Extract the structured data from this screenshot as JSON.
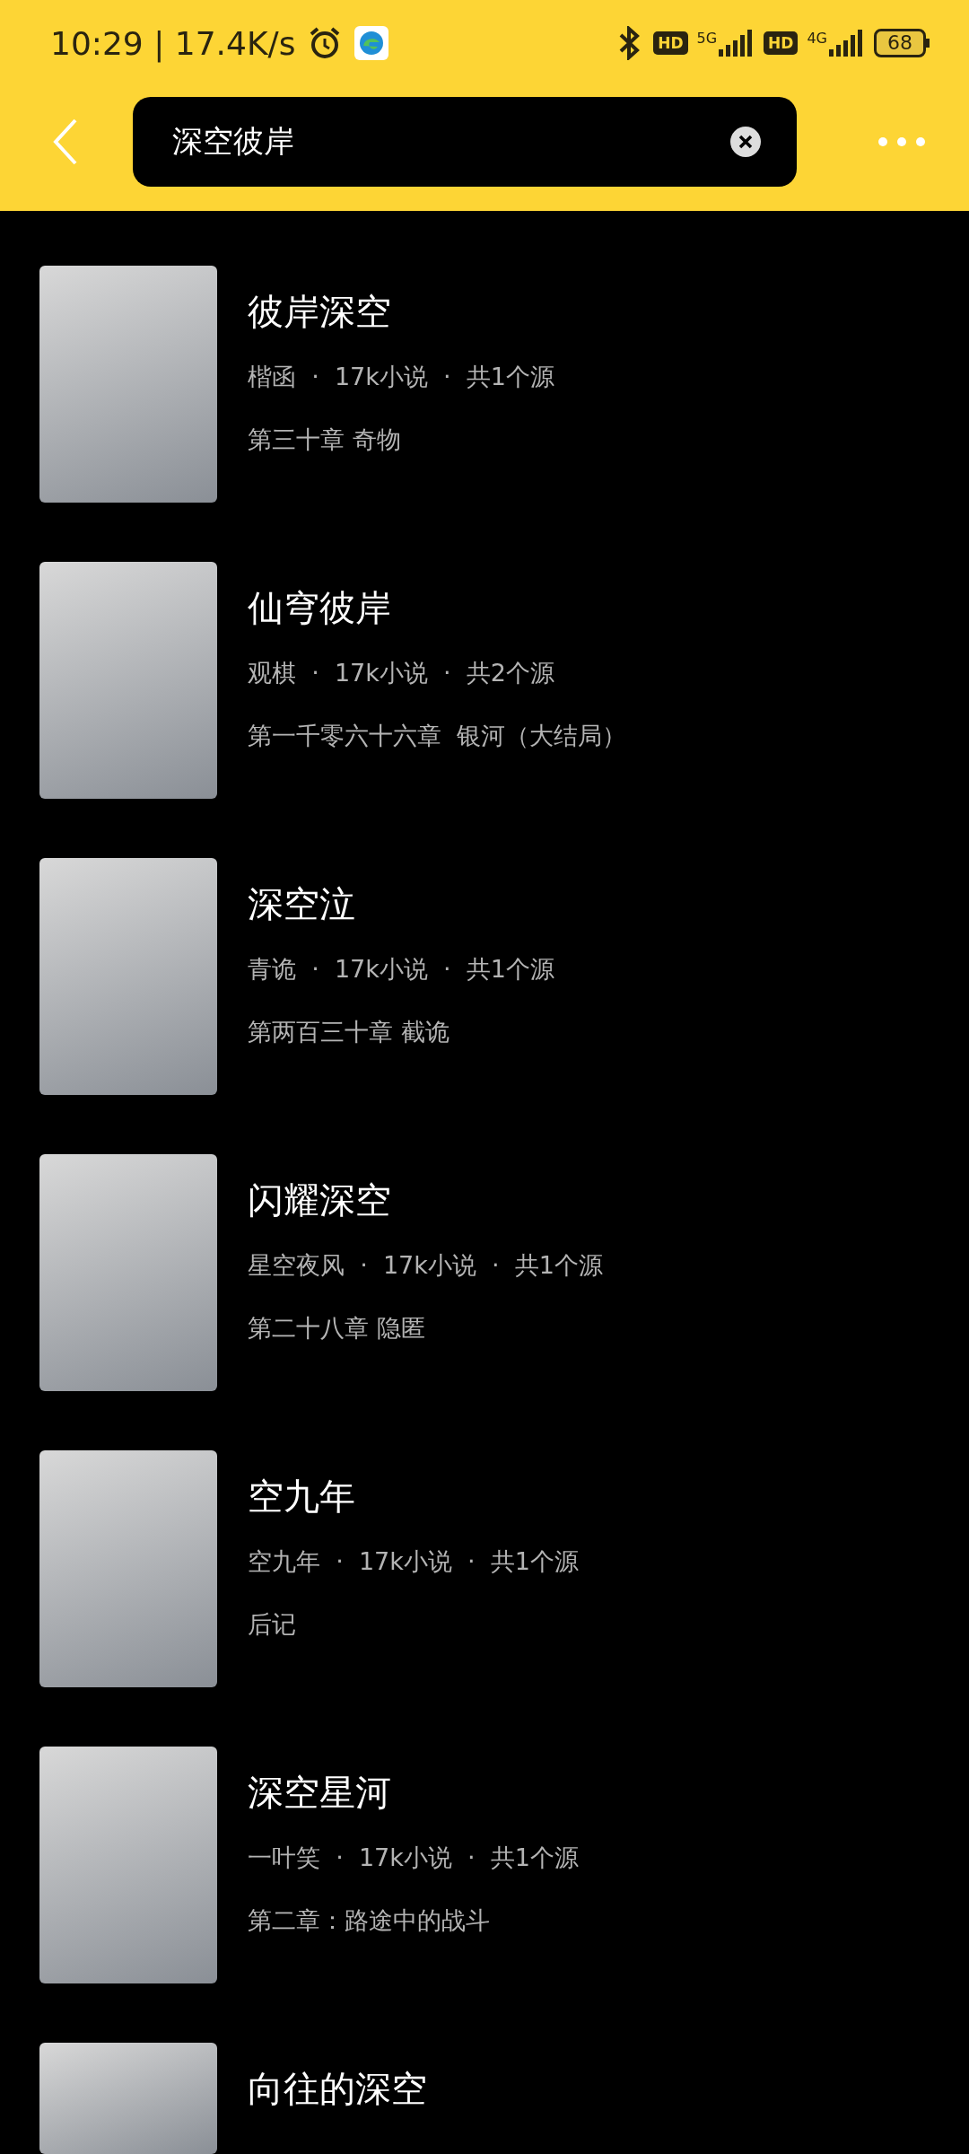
{
  "status_bar": {
    "time": "10:29 | 17.4K/s",
    "hd_1": "HD",
    "network_1": "5G",
    "hd_2": "HD",
    "network_2": "4G",
    "battery": "68"
  },
  "search": {
    "value": "深空彼岸"
  },
  "books": [
    {
      "title": "彼岸深空",
      "meta": "楷函  ·  17k小说  ·  共1个源",
      "chapter": "第三十章 奇物"
    },
    {
      "title": "仙穹彼岸",
      "meta": "观棋  ·  17k小说  ·  共2个源",
      "chapter": "第一千零六十六章  银河（大结局）"
    },
    {
      "title": "深空泣",
      "meta": "青诡  ·  17k小说  ·  共1个源",
      "chapter": "第两百三十章 截诡"
    },
    {
      "title": "闪耀深空",
      "meta": "星空夜风  ·  17k小说  ·  共1个源",
      "chapter": "第二十八章 隐匿"
    },
    {
      "title": "空九年",
      "meta": "空九年  ·  17k小说  ·  共1个源",
      "chapter": "后记"
    },
    {
      "title": "深空星河",
      "meta": "一叶笑  ·  17k小说  ·  共1个源",
      "chapter": "第二章：路途中的战斗"
    },
    {
      "title": "向往的深空"
    }
  ]
}
